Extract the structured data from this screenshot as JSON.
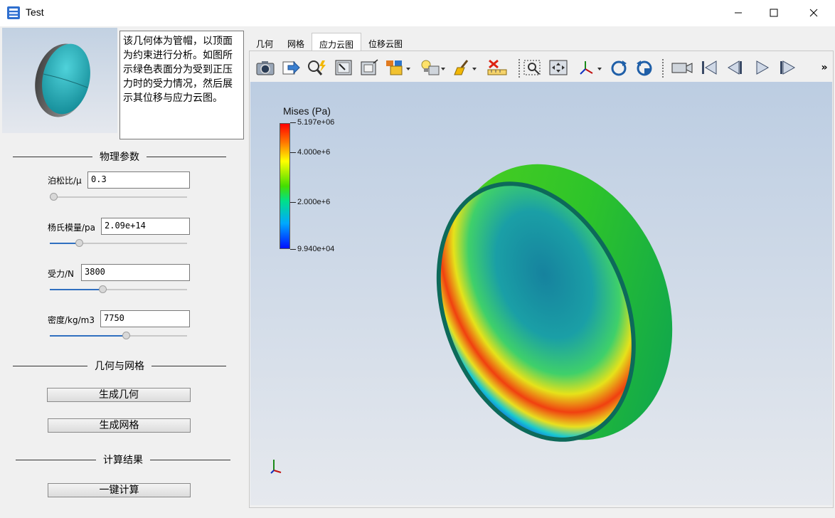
{
  "window": {
    "title": "Test"
  },
  "description": "该几何体为管帽，以顶面为约束进行分析。如图所示绿色表面分为受到正压力时的受力情况，然后展示其位移与应力云图。",
  "sections": {
    "physics": "物理参数",
    "geometry_mesh": "几何与网格",
    "results": "计算结果"
  },
  "params": [
    {
      "label": "泊松比/μ",
      "value": "0.3",
      "level": 0.0
    },
    {
      "label": "杨氏模量/pa",
      "value": "2.09e+14",
      "level": 0.2
    },
    {
      "label": "受力/N",
      "value": "3800",
      "level": 0.38
    },
    {
      "label": "密度/kg/m3",
      "value": "7750",
      "level": 0.56
    }
  ],
  "buttons": {
    "gen_geometry": "生成几何",
    "gen_mesh": "生成网格",
    "compute": "一键计算"
  },
  "tabs": [
    "几何",
    "网格",
    "应力云图",
    "位移云图"
  ],
  "active_tab": "应力云图",
  "toolbar": {
    "icons": [
      "camera-icon",
      "export-icon",
      "probe-icon",
      "select-box-icon",
      "view-frame-icon",
      "display-style-icon",
      "light-bulb-icon",
      "clear-brush-icon",
      "delete-ruler-icon",
      "zoom-box-icon",
      "fit-view-icon",
      "axes-orient-icon",
      "rotate-cw-icon",
      "rotate-ccw-icon",
      "record-video-icon",
      "first-frame-icon",
      "prev-frame-icon",
      "play-icon",
      "last-frame-icon"
    ],
    "overflow": "»"
  },
  "legend": {
    "title": "Mises (Pa)",
    "max": "5.197e+06",
    "t1": "4.000e+6",
    "t2": "2.000e+6",
    "min": "9.940e+04"
  },
  "colors": {
    "accent": "#3070c0",
    "bg": "#f0f0f0"
  }
}
